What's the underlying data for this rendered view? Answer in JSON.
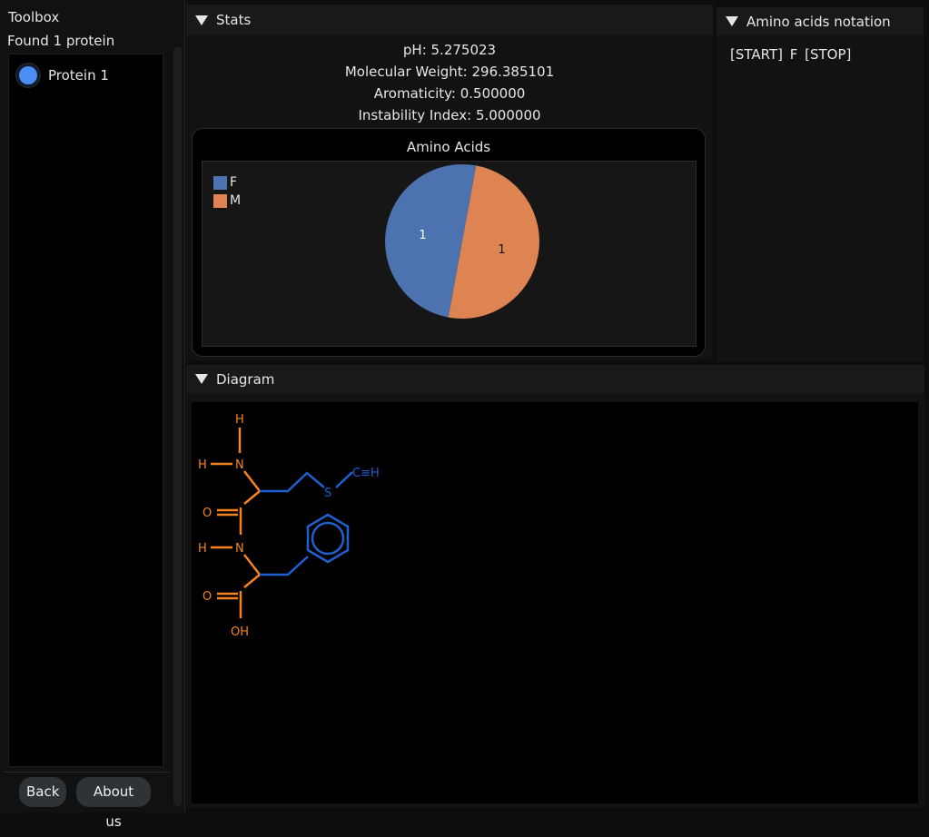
{
  "toolbox": {
    "title": "Toolbox",
    "found": "Found 1 protein",
    "items": [
      {
        "label": "Protein 1",
        "color": "#4d8df6"
      }
    ],
    "back_label": "Back",
    "about_label": "About us"
  },
  "stats": {
    "title": "Stats",
    "ph": "pH: 5.275023",
    "weight": "Molecular Weight: 296.385101",
    "aromaticity": "Aromaticity: 0.500000",
    "instability": "Instability Index: 5.000000"
  },
  "chart_data": {
    "type": "pie",
    "title": "Amino Acids",
    "categories": [
      "F",
      "M"
    ],
    "values": [
      1,
      1
    ],
    "colors": [
      "#4c72b0",
      "#dd8452"
    ],
    "legend": "top-left"
  },
  "notation": {
    "title": "Amino acids notation",
    "sequence": "[START]  F  [STOP]"
  },
  "diagram": {
    "title": "Diagram",
    "atoms": {
      "h": "H",
      "n": "N",
      "o": "O",
      "s": "S",
      "ch": "C≡H",
      "oh": "OH"
    },
    "colors": {
      "backbone": "#f5841f",
      "sidechain": "#1f5fcf"
    }
  }
}
